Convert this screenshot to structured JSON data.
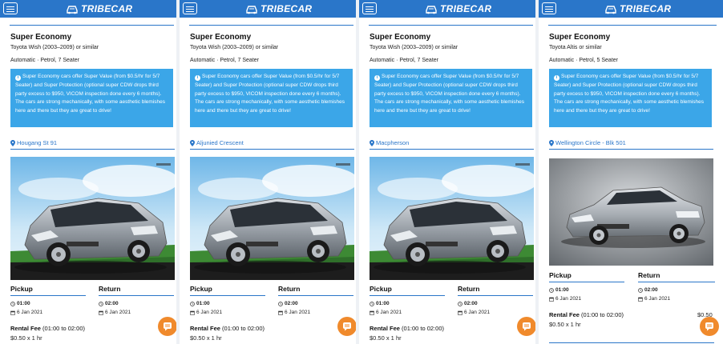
{
  "brand": {
    "name": "TRIBECAR",
    "header_color": "#2a76c9",
    "accent_color": "#3ba6e8",
    "chat_color": "#f08a2c"
  },
  "icons": {
    "menu": "hamburger-menu-icon",
    "info": "info-circle-icon",
    "location": "map-pin-icon",
    "time": "clock-icon",
    "date": "calendar-icon",
    "chat": "chat-bubble-icon",
    "logo": "car-logo-icon"
  },
  "panels": [
    {
      "plan_title": "Super Economy",
      "model": "Toyota Wish (2003–2009) or similar",
      "specs": "Automatic · Petrol, 7 Seater",
      "info": "Super Economy cars offer Super Value (from $0.5/hr for 5/7 Seater) and Super Protection (optional super CDW drops third party excess to $950, VICOM inspection done every 6 months). The cars are strong mechanically, with some aesthetic blemishes here and there but they are great to drive!",
      "location": "Hougang St 91",
      "car": "mpv",
      "pickup_label": "Pickup",
      "return_label": "Return",
      "pickup_time": "01:00",
      "return_time": "02:00",
      "pickup_date": "6 Jan 2021",
      "return_date": "6 Jan 2021",
      "fee_label": "Rental Fee",
      "fee_range": "(01:00 to 02:00)",
      "fee_calc": "$0.50 x 1 hr",
      "fee_total": ""
    },
    {
      "plan_title": "Super Economy",
      "model": "Toyota Wish (2003–2009) or similar",
      "specs": "Automatic · Petrol, 7 Seater",
      "info": "Super Economy cars offer Super Value (from $0.5/hr for 5/7 Seater) and Super Protection (optional super CDW drops third party excess to $950, VICOM inspection done every 6 months). The cars are strong mechanically, with some aesthetic blemishes here and there but they are great to drive!",
      "location": "Aljunied Crescent",
      "car": "mpv",
      "pickup_label": "Pickup",
      "return_label": "Return",
      "pickup_time": "01:00",
      "return_time": "02:00",
      "pickup_date": "6 Jan 2021",
      "return_date": "6 Jan 2021",
      "fee_label": "Rental Fee",
      "fee_range": "(01:00 to 02:00)",
      "fee_calc": "$0.50 x 1 hr",
      "fee_total": ""
    },
    {
      "plan_title": "Super Economy",
      "model": "Toyota Wish (2003–2009) or similar",
      "specs": "Automatic · Petrol, 7 Seater",
      "info": "Super Economy cars offer Super Value (from $0.5/hr for 5/7 Seater) and Super Protection (optional super CDW drops third party excess to $950, VICOM inspection done every 6 months). The cars are strong mechanically, with some aesthetic blemishes here and there but they are great to drive!",
      "location": "Macpherson",
      "car": "mpv",
      "pickup_label": "Pickup",
      "return_label": "Return",
      "pickup_time": "01:00",
      "return_time": "02:00",
      "pickup_date": "6 Jan 2021",
      "return_date": "6 Jan 2021",
      "fee_label": "Rental Fee",
      "fee_range": "(01:00 to 02:00)",
      "fee_calc": "$0.50 x 1 hr",
      "fee_total": ""
    },
    {
      "plan_title": "Super Economy",
      "model": "Toyota Altis or similar",
      "specs": "Automatic · Petrol, 5 Seater",
      "info": "Super Economy cars offer Super Value (from $0.5/hr for 5/7 Seater) and Super Protection (optional super CDW drops third party excess to $950, VICOM inspection done every 6 months). The cars are strong mechanically, with some aesthetic blemishes here and there but they are great to drive!",
      "location": "Wellington Circle - Blk 501",
      "car": "sedan",
      "pickup_label": "Pickup",
      "return_label": "Return",
      "pickup_time": "01:00",
      "return_time": "02:00",
      "pickup_date": "6 Jan 2021",
      "return_date": "6 Jan 2021",
      "fee_label": "Rental Fee",
      "fee_range": "(01:00 to 02:00)",
      "fee_calc": "$0.50 x 1 hr",
      "fee_total": "$0.50"
    }
  ]
}
